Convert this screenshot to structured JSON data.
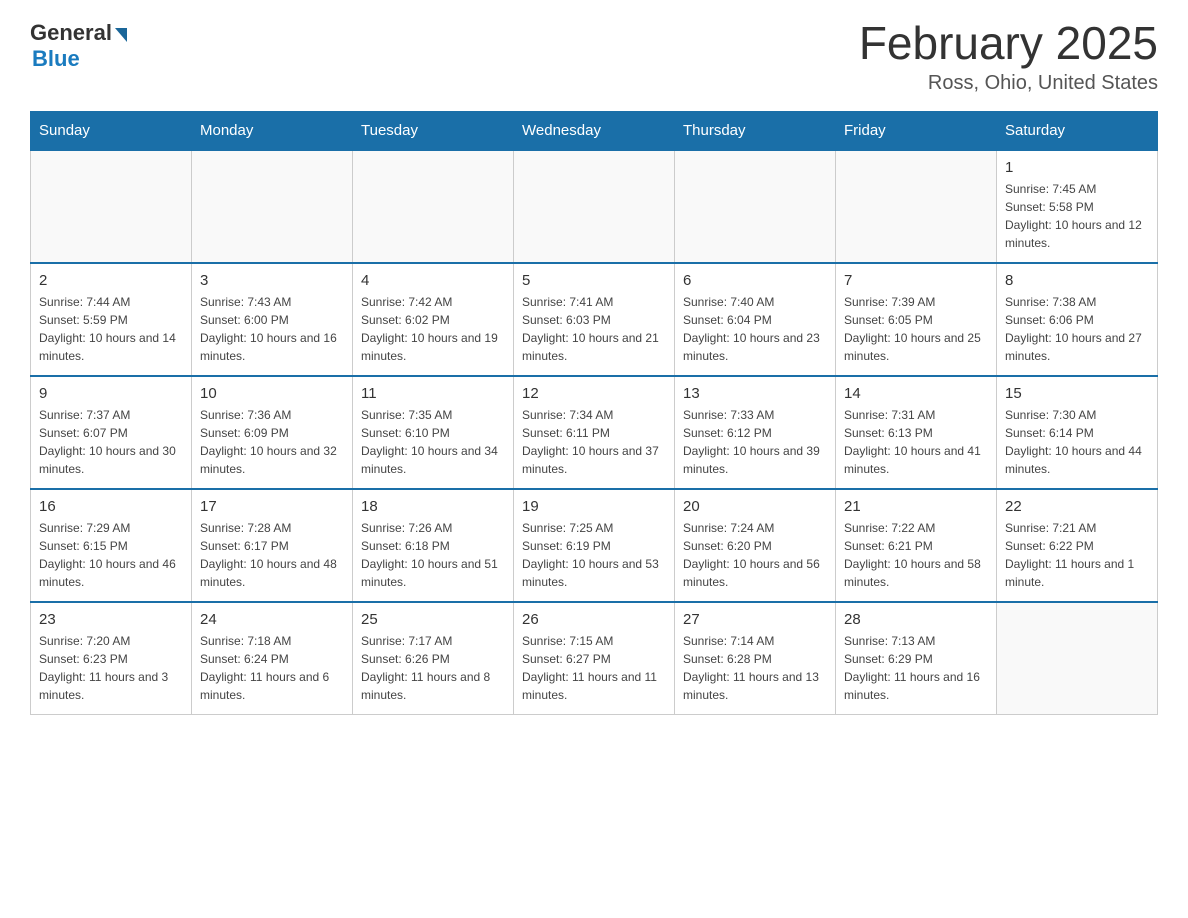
{
  "header": {
    "logo_general": "General",
    "logo_blue": "Blue",
    "title": "February 2025",
    "location": "Ross, Ohio, United States"
  },
  "days_of_week": [
    "Sunday",
    "Monday",
    "Tuesday",
    "Wednesday",
    "Thursday",
    "Friday",
    "Saturday"
  ],
  "weeks": [
    {
      "days": [
        {
          "num": "",
          "info": ""
        },
        {
          "num": "",
          "info": ""
        },
        {
          "num": "",
          "info": ""
        },
        {
          "num": "",
          "info": ""
        },
        {
          "num": "",
          "info": ""
        },
        {
          "num": "",
          "info": ""
        },
        {
          "num": "1",
          "info": "Sunrise: 7:45 AM\nSunset: 5:58 PM\nDaylight: 10 hours and 12 minutes."
        }
      ]
    },
    {
      "days": [
        {
          "num": "2",
          "info": "Sunrise: 7:44 AM\nSunset: 5:59 PM\nDaylight: 10 hours and 14 minutes."
        },
        {
          "num": "3",
          "info": "Sunrise: 7:43 AM\nSunset: 6:00 PM\nDaylight: 10 hours and 16 minutes."
        },
        {
          "num": "4",
          "info": "Sunrise: 7:42 AM\nSunset: 6:02 PM\nDaylight: 10 hours and 19 minutes."
        },
        {
          "num": "5",
          "info": "Sunrise: 7:41 AM\nSunset: 6:03 PM\nDaylight: 10 hours and 21 minutes."
        },
        {
          "num": "6",
          "info": "Sunrise: 7:40 AM\nSunset: 6:04 PM\nDaylight: 10 hours and 23 minutes."
        },
        {
          "num": "7",
          "info": "Sunrise: 7:39 AM\nSunset: 6:05 PM\nDaylight: 10 hours and 25 minutes."
        },
        {
          "num": "8",
          "info": "Sunrise: 7:38 AM\nSunset: 6:06 PM\nDaylight: 10 hours and 27 minutes."
        }
      ]
    },
    {
      "days": [
        {
          "num": "9",
          "info": "Sunrise: 7:37 AM\nSunset: 6:07 PM\nDaylight: 10 hours and 30 minutes."
        },
        {
          "num": "10",
          "info": "Sunrise: 7:36 AM\nSunset: 6:09 PM\nDaylight: 10 hours and 32 minutes."
        },
        {
          "num": "11",
          "info": "Sunrise: 7:35 AM\nSunset: 6:10 PM\nDaylight: 10 hours and 34 minutes."
        },
        {
          "num": "12",
          "info": "Sunrise: 7:34 AM\nSunset: 6:11 PM\nDaylight: 10 hours and 37 minutes."
        },
        {
          "num": "13",
          "info": "Sunrise: 7:33 AM\nSunset: 6:12 PM\nDaylight: 10 hours and 39 minutes."
        },
        {
          "num": "14",
          "info": "Sunrise: 7:31 AM\nSunset: 6:13 PM\nDaylight: 10 hours and 41 minutes."
        },
        {
          "num": "15",
          "info": "Sunrise: 7:30 AM\nSunset: 6:14 PM\nDaylight: 10 hours and 44 minutes."
        }
      ]
    },
    {
      "days": [
        {
          "num": "16",
          "info": "Sunrise: 7:29 AM\nSunset: 6:15 PM\nDaylight: 10 hours and 46 minutes."
        },
        {
          "num": "17",
          "info": "Sunrise: 7:28 AM\nSunset: 6:17 PM\nDaylight: 10 hours and 48 minutes."
        },
        {
          "num": "18",
          "info": "Sunrise: 7:26 AM\nSunset: 6:18 PM\nDaylight: 10 hours and 51 minutes."
        },
        {
          "num": "19",
          "info": "Sunrise: 7:25 AM\nSunset: 6:19 PM\nDaylight: 10 hours and 53 minutes."
        },
        {
          "num": "20",
          "info": "Sunrise: 7:24 AM\nSunset: 6:20 PM\nDaylight: 10 hours and 56 minutes."
        },
        {
          "num": "21",
          "info": "Sunrise: 7:22 AM\nSunset: 6:21 PM\nDaylight: 10 hours and 58 minutes."
        },
        {
          "num": "22",
          "info": "Sunrise: 7:21 AM\nSunset: 6:22 PM\nDaylight: 11 hours and 1 minute."
        }
      ]
    },
    {
      "days": [
        {
          "num": "23",
          "info": "Sunrise: 7:20 AM\nSunset: 6:23 PM\nDaylight: 11 hours and 3 minutes."
        },
        {
          "num": "24",
          "info": "Sunrise: 7:18 AM\nSunset: 6:24 PM\nDaylight: 11 hours and 6 minutes."
        },
        {
          "num": "25",
          "info": "Sunrise: 7:17 AM\nSunset: 6:26 PM\nDaylight: 11 hours and 8 minutes."
        },
        {
          "num": "26",
          "info": "Sunrise: 7:15 AM\nSunset: 6:27 PM\nDaylight: 11 hours and 11 minutes."
        },
        {
          "num": "27",
          "info": "Sunrise: 7:14 AM\nSunset: 6:28 PM\nDaylight: 11 hours and 13 minutes."
        },
        {
          "num": "28",
          "info": "Sunrise: 7:13 AM\nSunset: 6:29 PM\nDaylight: 11 hours and 16 minutes."
        },
        {
          "num": "",
          "info": ""
        }
      ]
    }
  ]
}
